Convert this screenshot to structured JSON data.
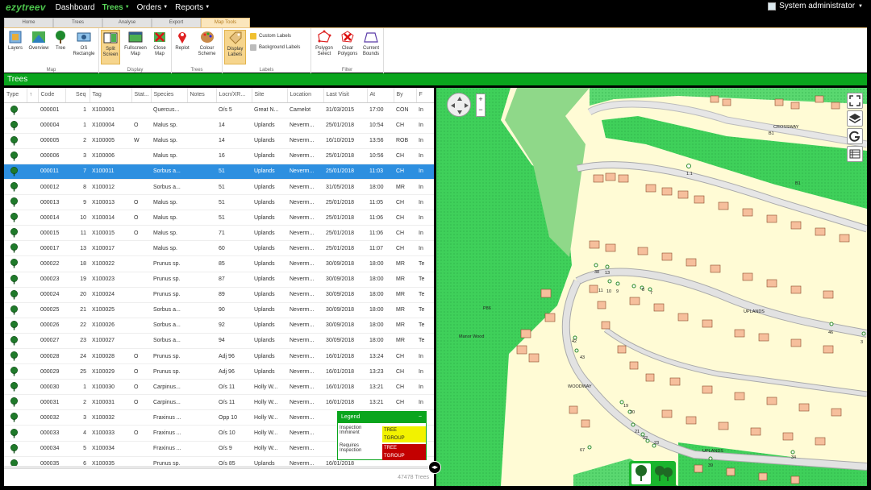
{
  "app": {
    "logo": "ezytreev",
    "nav": [
      {
        "label": "Dashboard",
        "active": false,
        "caret": false
      },
      {
        "label": "Trees",
        "active": true,
        "caret": true
      },
      {
        "label": "Orders",
        "active": false,
        "caret": true
      },
      {
        "label": "Reports",
        "active": false,
        "caret": true
      }
    ],
    "user": "System administrator"
  },
  "ribbon": {
    "tabs": [
      "Home",
      "Trees",
      "Analyse",
      "Export",
      "Map Tools"
    ],
    "active_tab": "Map Tools",
    "groups": {
      "map": {
        "label": "Map",
        "buttons": [
          "Layers",
          "Overview",
          "Tree",
          "OS Rectangle"
        ]
      },
      "display": {
        "label": "Display",
        "buttons": [
          "Split Screen",
          "Fullscreen Map",
          "Close Map"
        ]
      },
      "trees": {
        "label": "Trees",
        "buttons": [
          "Replot",
          "Colour Scheme"
        ]
      },
      "labels": {
        "label": "Labels",
        "buttons": [
          "Display Labels",
          "Custom Labels",
          "Background Labels"
        ]
      },
      "filter": {
        "label": "Filter",
        "buttons": [
          "Polygon Select",
          "Clear Polygons",
          "Current Bounds"
        ]
      }
    }
  },
  "panel_title": "Trees",
  "grid": {
    "columns": [
      "Type",
      "↑",
      "Code",
      "Seq",
      "Stat...",
      "Species",
      "Notes",
      "Locn/XR...",
      "Site",
      "Location",
      "Last Visit",
      "At",
      "By",
      "F"
    ],
    "rows": [
      [
        "000001",
        "1",
        "X100001",
        "",
        "Quercus...",
        "",
        "O/s 5",
        "Great N...",
        "Camelot",
        "31/03/2015",
        "17:00",
        "CON",
        "In"
      ],
      [
        "000004",
        "1",
        "X100004",
        "O",
        "Malus sp.",
        "",
        "14",
        "Uplands",
        "Neverm...",
        "25/01/2018",
        "10:54",
        "CH",
        "In"
      ],
      [
        "000005",
        "2",
        "X100005",
        "W",
        "Malus sp.",
        "",
        "14",
        "Uplands",
        "Neverm...",
        "16/10/2019",
        "13:56",
        "ROB",
        "In"
      ],
      [
        "000006",
        "3",
        "X100006",
        "",
        "Malus sp.",
        "",
        "16",
        "Uplands",
        "Neverm...",
        "25/01/2018",
        "10:56",
        "CH",
        "In"
      ],
      [
        "000011",
        "7",
        "X100011",
        "",
        "Sorbus a...",
        "",
        "51",
        "Uplands",
        "Neverm...",
        "25/01/2018",
        "11:03",
        "CH",
        "In"
      ],
      [
        "000012",
        "8",
        "X100012",
        "",
        "Sorbus a...",
        "",
        "51",
        "Uplands",
        "Neverm...",
        "31/05/2018",
        "18:00",
        "MR",
        "In"
      ],
      [
        "000013",
        "9",
        "X100013",
        "O",
        "Malus sp.",
        "",
        "51",
        "Uplands",
        "Neverm...",
        "25/01/2018",
        "11:05",
        "CH",
        "In"
      ],
      [
        "000014",
        "10",
        "X100014",
        "O",
        "Malus sp.",
        "",
        "51",
        "Uplands",
        "Neverm...",
        "25/01/2018",
        "11:06",
        "CH",
        "In"
      ],
      [
        "000015",
        "11",
        "X100015",
        "O",
        "Malus sp.",
        "",
        "71",
        "Uplands",
        "Neverm...",
        "25/01/2018",
        "11:06",
        "CH",
        "In"
      ],
      [
        "000017",
        "13",
        "X100017",
        "",
        "Malus sp.",
        "",
        "60",
        "Uplands",
        "Neverm...",
        "25/01/2018",
        "11:07",
        "CH",
        "In"
      ],
      [
        "000022",
        "18",
        "X100022",
        "",
        "Prunus sp.",
        "",
        "85",
        "Uplands",
        "Neverm...",
        "30/09/2018",
        "18:00",
        "MR",
        "Te"
      ],
      [
        "000023",
        "19",
        "X100023",
        "",
        "Prunus sp.",
        "",
        "87",
        "Uplands",
        "Neverm...",
        "30/09/2018",
        "18:00",
        "MR",
        "Te"
      ],
      [
        "000024",
        "20",
        "X100024",
        "",
        "Prunus sp.",
        "",
        "89",
        "Uplands",
        "Neverm...",
        "30/09/2018",
        "18:00",
        "MR",
        "Te"
      ],
      [
        "000025",
        "21",
        "X100025",
        "",
        "Sorbus a...",
        "",
        "90",
        "Uplands",
        "Neverm...",
        "30/09/2018",
        "18:00",
        "MR",
        "Te"
      ],
      [
        "000026",
        "22",
        "X100026",
        "",
        "Sorbus a...",
        "",
        "92",
        "Uplands",
        "Neverm...",
        "30/09/2018",
        "18:00",
        "MR",
        "Te"
      ],
      [
        "000027",
        "23",
        "X100027",
        "",
        "Sorbus a...",
        "",
        "94",
        "Uplands",
        "Neverm...",
        "30/09/2018",
        "18:00",
        "MR",
        "Te"
      ],
      [
        "000028",
        "24",
        "X100028",
        "O",
        "Prunus sp.",
        "",
        "Adj 96",
        "Uplands",
        "Neverm...",
        "16/01/2018",
        "13:24",
        "CH",
        "In"
      ],
      [
        "000029",
        "25",
        "X100029",
        "O",
        "Prunus sp.",
        "",
        "Adj 96",
        "Uplands",
        "Neverm...",
        "16/01/2018",
        "13:23",
        "CH",
        "In"
      ],
      [
        "000030",
        "1",
        "X100030",
        "O",
        "Carpinus...",
        "",
        "O/s 11",
        "Holly W...",
        "Neverm...",
        "16/01/2018",
        "13:21",
        "CH",
        "In"
      ],
      [
        "000031",
        "2",
        "X100031",
        "O",
        "Carpinus...",
        "",
        "O/s 11",
        "Holly W...",
        "Neverm...",
        "16/01/2018",
        "13:21",
        "CH",
        "In"
      ],
      [
        "000032",
        "3",
        "X100032",
        "",
        "Fraxinus ...",
        "",
        "Opp 10",
        "Holly W...",
        "Neverm...",
        "",
        "",
        "",
        ""
      ],
      [
        "000033",
        "4",
        "X100033",
        "O",
        "Fraxinus ...",
        "",
        "O/s 10",
        "Holly W...",
        "Neverm...",
        "",
        "",
        "",
        ""
      ],
      [
        "000034",
        "5",
        "X100034",
        "",
        "Fraxinus ...",
        "",
        "O/s 9",
        "Holly W...",
        "Neverm...",
        "",
        "",
        "",
        ""
      ],
      [
        "000035",
        "6",
        "X100035",
        "",
        "Prunus sp.",
        "",
        "O/s 85",
        "Uplands",
        "Neverm...",
        "16/01/2018",
        "",
        "",
        ""
      ]
    ],
    "selected_code": "000011",
    "count": "47478 Trees"
  },
  "legend": {
    "title": "Legend",
    "rows": [
      {
        "label": "Inspection Imminent",
        "items": [
          "TREE",
          "TGROUP"
        ],
        "color": "#f2f200"
      },
      {
        "label": "Requires Inspection",
        "items": [
          "TREE",
          "TGROUP"
        ],
        "color": "#c30000"
      }
    ]
  },
  "map_labels": {
    "roads": [
      "CROSSWAY",
      "UPLANDS",
      "UPLANDS",
      "WOODWAY"
    ],
    "places": [
      "Manor Wood",
      "P86",
      "B1",
      "B1"
    ],
    "tree_numbers": [
      "1.1",
      "38",
      "13",
      "11",
      "10",
      "9",
      "8",
      "7",
      "42",
      "43",
      "19",
      "20",
      "21",
      "22",
      "23",
      "46",
      "3",
      "34",
      "39",
      "67"
    ]
  },
  "colors": {
    "accent": "#0aa51d",
    "selected_row": "#2d8fe0",
    "map_green": "#3fd05a",
    "ribbon_active": "#f6d58d"
  }
}
